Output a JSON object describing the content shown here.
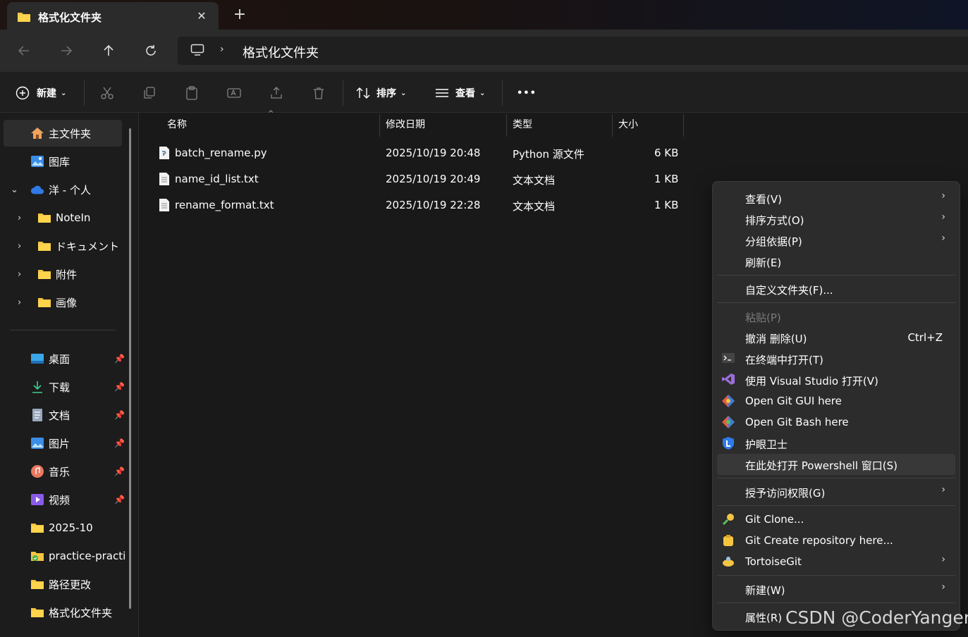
{
  "tab": {
    "title": "格式化文件夹",
    "close_label": "✕",
    "new_label": "+"
  },
  "address": {
    "crumb": "格式化文件夹",
    "separator": "›"
  },
  "toolbar": {
    "new_label": "新建",
    "sort_label": "排序",
    "view_label": "查看",
    "more_label": "•••"
  },
  "sidebar": {
    "items": [
      {
        "label": "主文件夹"
      },
      {
        "label": "图库"
      },
      {
        "label": "洋 - 个人"
      },
      {
        "label": "NoteIn"
      },
      {
        "label": "ドキュメント"
      },
      {
        "label": "附件"
      },
      {
        "label": "画像"
      }
    ],
    "pinned": [
      {
        "label": "桌面"
      },
      {
        "label": "下载"
      },
      {
        "label": "文档"
      },
      {
        "label": "图片"
      },
      {
        "label": "音乐"
      },
      {
        "label": "视频"
      },
      {
        "label": "2025-10"
      },
      {
        "label": "practice-practi"
      },
      {
        "label": "路径更改"
      },
      {
        "label": "格式化文件夹"
      }
    ]
  },
  "list": {
    "columns": {
      "name": "名称",
      "modified": "修改日期",
      "type": "类型",
      "size": "大小"
    },
    "rows": [
      {
        "name": "batch_rename.py",
        "modified": "2025/10/19 20:48",
        "type": "Python 源文件",
        "size": "6 KB"
      },
      {
        "name": "name_id_list.txt",
        "modified": "2025/10/19 20:49",
        "type": "文本文档",
        "size": "1 KB"
      },
      {
        "name": "rename_format.txt",
        "modified": "2025/10/19 22:28",
        "type": "文本文档",
        "size": "1 KB"
      }
    ]
  },
  "context_menu": {
    "view": "查看(V)",
    "sort": "排序方式(O)",
    "group": "分组依据(P)",
    "refresh": "刷新(E)",
    "customize": "自定义文件夹(F)...",
    "paste": "粘贴(P)",
    "undo": "撤消 删除(U)",
    "undo_shortcut": "Ctrl+Z",
    "terminal": "在终端中打开(T)",
    "visual_studio": "使用 Visual Studio 打开(V)",
    "git_gui": "Open Git GUI here",
    "git_bash": "Open Git Bash here",
    "eye_guard": "护眼卫士",
    "powershell": "在此处打开 Powershell 窗口(S)",
    "grant_access": "授予访问权限(G)",
    "git_clone": "Git Clone...",
    "git_create": "Git Create repository here...",
    "tortoisegit": "TortoiseGit",
    "new": "新建(W)",
    "properties": "属性(R)",
    "submenu_arrow": "›"
  },
  "watermark": "CSDN @CoderYanger",
  "colors": {
    "folder": "#f5c542",
    "accent": "#4cc2ff",
    "menu_bg": "#2c2c2c"
  }
}
